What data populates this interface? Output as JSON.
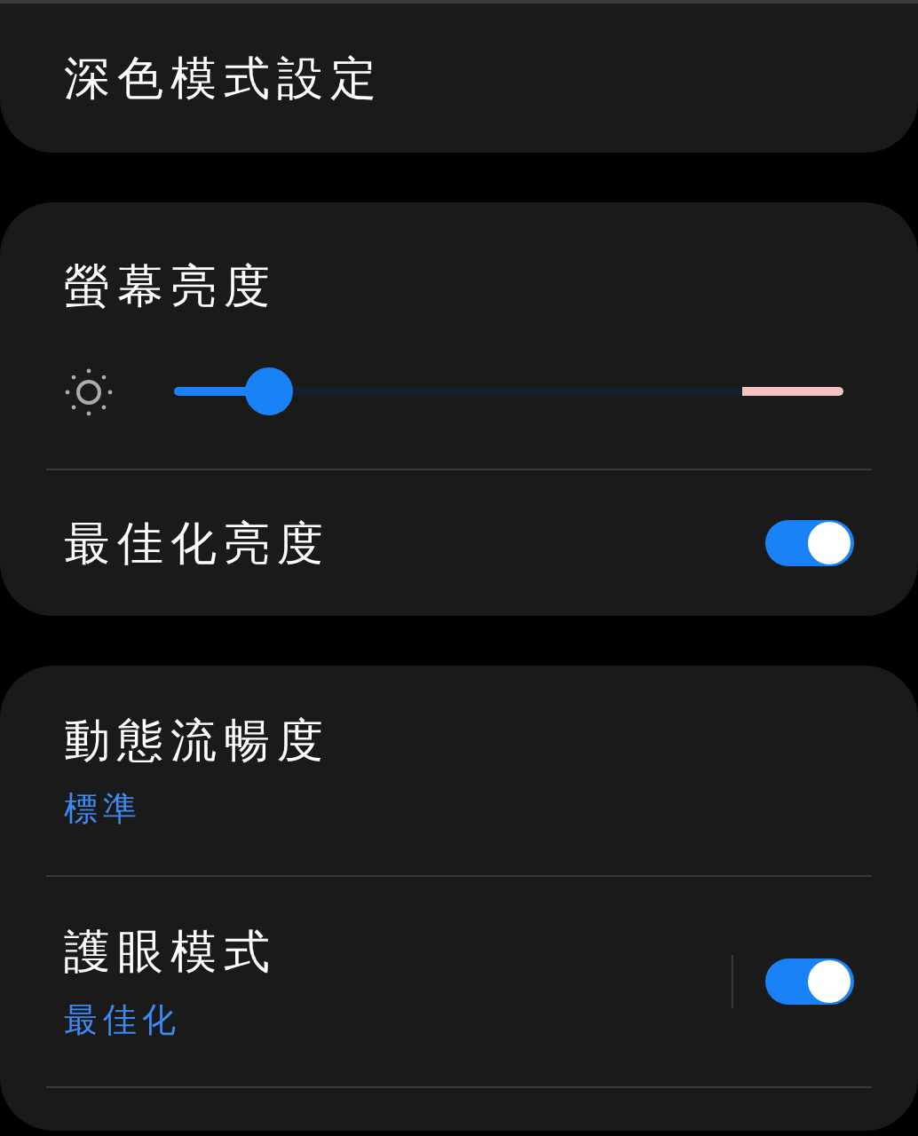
{
  "cards": [
    {
      "rows": [
        {
          "kind": "link",
          "title": "深色模式設定"
        }
      ]
    },
    {
      "rows": [
        {
          "kind": "slider",
          "title": "螢幕亮度",
          "level": 0.14
        },
        {
          "kind": "toggle",
          "title": "最佳化亮度",
          "on": true
        }
      ]
    },
    {
      "rows": [
        {
          "kind": "link",
          "title": "動態流暢度",
          "subtitle": "標準"
        },
        {
          "kind": "toggle",
          "title": "護眼模式",
          "subtitle": "最佳化",
          "on": true,
          "separator": true
        }
      ]
    }
  ]
}
